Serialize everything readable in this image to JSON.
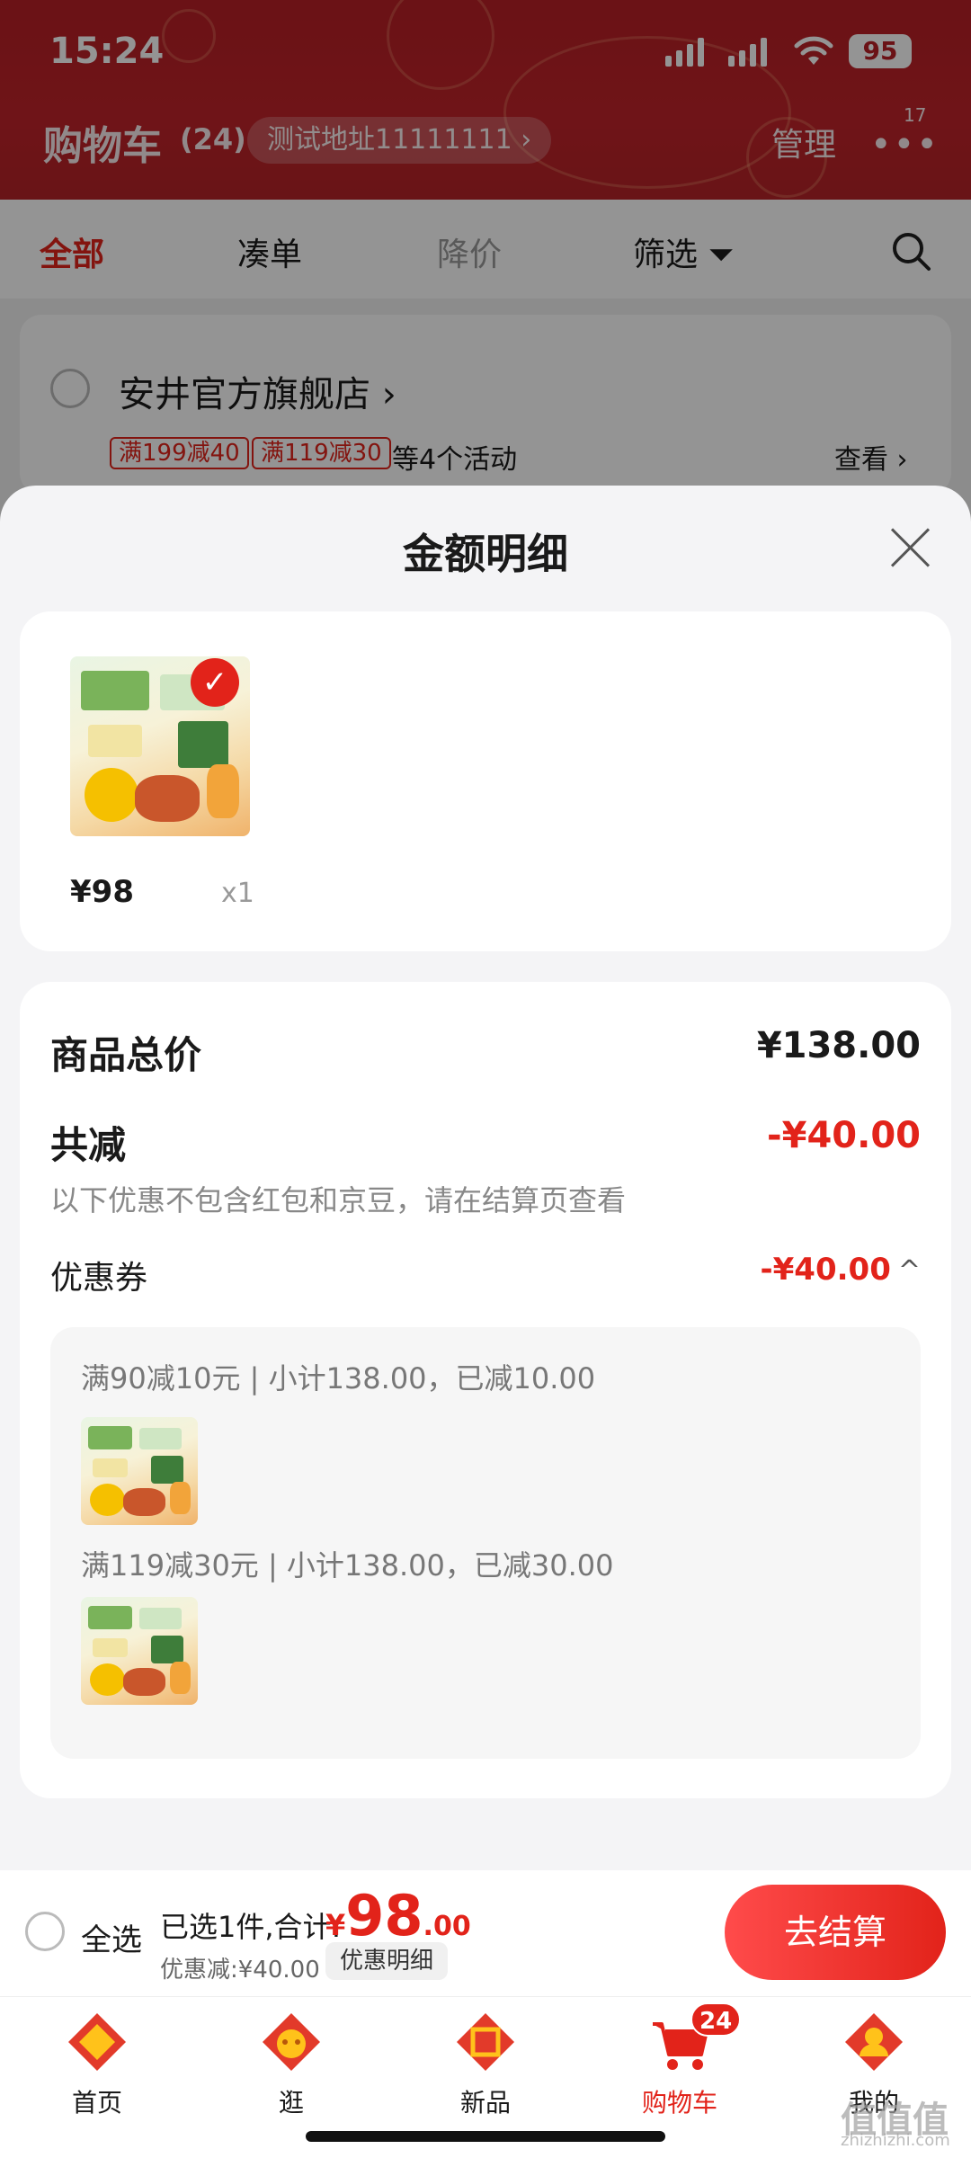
{
  "status_bar": {
    "time": "15:24",
    "battery": "95"
  },
  "header": {
    "title": "购物车",
    "count": "(24)",
    "address": "测试地址11111111 ›",
    "manage": "管理",
    "more": "•••",
    "more_badge": "17"
  },
  "filter_tabs": {
    "all": "全部",
    "bundle": "凑单",
    "price_drop": "降价",
    "filter": "筛选 ⏷",
    "search_icon": "search-icon"
  },
  "store": {
    "name": "安井官方旗舰店 ›",
    "tags": [
      "满199减40",
      "满119减30"
    ],
    "more_text": "等4个活动",
    "view": "查看 ›"
  },
  "sheet": {
    "title": "金额明细",
    "product": {
      "price": "¥98",
      "qty": "x1",
      "checked": "✓"
    },
    "summary": {
      "total_label": "商品总价",
      "total_value": "¥138.00",
      "reduce_label": "共减",
      "reduce_value": "-¥40.00",
      "note": "以下优惠不包含红包和京豆，请在结算页查看",
      "coupon_label": "优惠券",
      "coupon_value": "-¥40.00",
      "coupon_caret": "^"
    },
    "coupons": [
      {
        "text": "满90减10元 | 小计138.00，已减10.00"
      },
      {
        "text": "满119减30元 | 小计138.00，已减30.00"
      }
    ]
  },
  "bottom_bar": {
    "select_all": "全选",
    "selected_text": "已选1件,合计:",
    "currency": "¥",
    "total_int": "98",
    "total_dec": ".00",
    "discount_text": "优惠减:¥40.00",
    "detail_button": "优惠明细",
    "checkout": "去结算"
  },
  "tabbar": {
    "items": [
      {
        "label": "首页",
        "icon": "home-icon"
      },
      {
        "label": "逛",
        "icon": "stroll-icon"
      },
      {
        "label": "新品",
        "icon": "new-products-icon"
      },
      {
        "label": "购物车",
        "icon": "cart-icon",
        "badge": "24"
      },
      {
        "label": "我的",
        "icon": "profile-icon"
      }
    ]
  },
  "watermark": {
    "main": "值值值",
    "sub": "zhizhizhi.com"
  },
  "colors": {
    "brand_red": "#e2231a",
    "header_red": "#b81f26"
  }
}
